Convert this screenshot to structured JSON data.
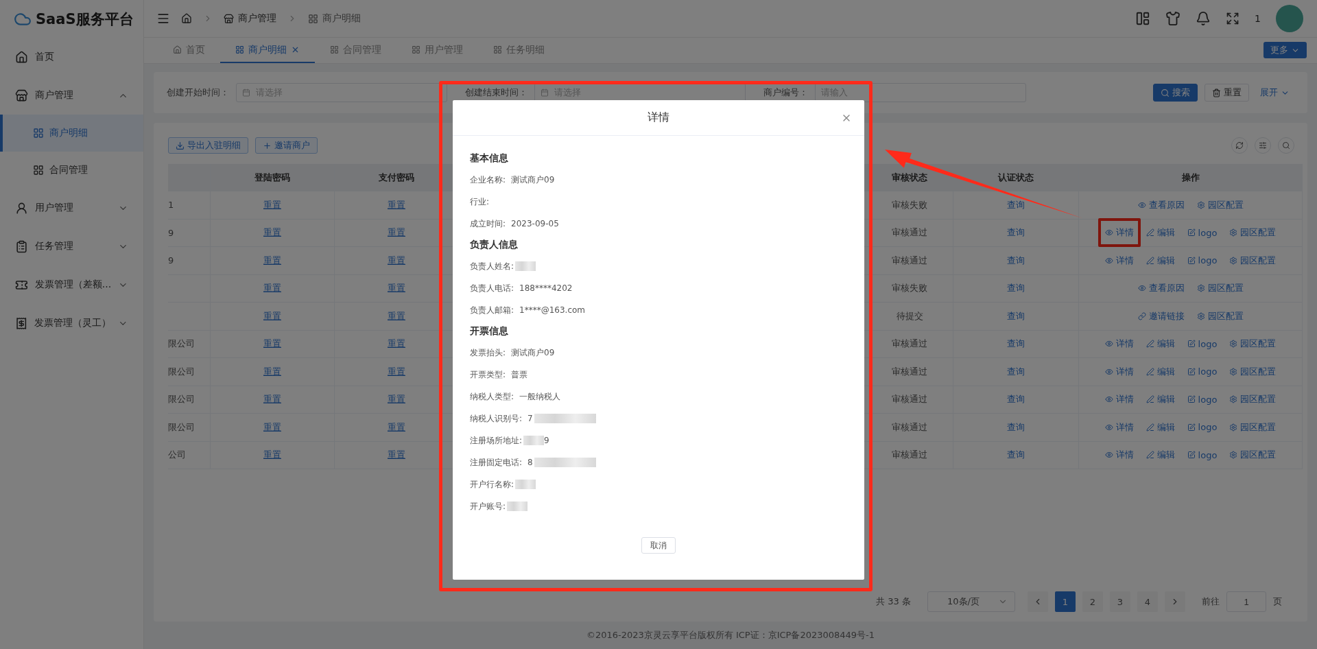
{
  "sidebar": {
    "logo": "SaaS服务平台",
    "items": [
      {
        "kind": "link",
        "label": "首页",
        "selected": false
      },
      {
        "kind": "group",
        "label": "商户管理",
        "expanded": true,
        "children": [
          {
            "label": "商户明细",
            "selected": true
          },
          {
            "label": "合同管理",
            "selected": false
          }
        ]
      },
      {
        "kind": "group",
        "label": "用户管理",
        "expanded": false
      },
      {
        "kind": "group",
        "label": "任务管理",
        "expanded": false
      },
      {
        "kind": "group",
        "label": "发票管理（差额...",
        "expanded": false
      },
      {
        "kind": "group",
        "label": "发票管理（灵工）",
        "expanded": false
      }
    ]
  },
  "header": {
    "breadcrumb": [
      "商户管理",
      "商户明细"
    ],
    "user_count": "1"
  },
  "tabs": [
    {
      "label": "首页",
      "selected": false,
      "closable": false
    },
    {
      "label": "商户明细",
      "selected": true,
      "closable": true
    },
    {
      "label": "合同管理",
      "selected": false,
      "closable": false
    },
    {
      "label": "用户管理",
      "selected": false,
      "closable": false
    },
    {
      "label": "任务明细",
      "selected": false,
      "closable": false
    }
  ],
  "more_button": "更多",
  "filters": [
    {
      "label": "创建开始时间：",
      "placeholder": "请选择",
      "kind": "date"
    },
    {
      "label": "创建结束时间：",
      "placeholder": "请选择",
      "kind": "date"
    },
    {
      "label": "商户编号：",
      "placeholder": "请输入",
      "kind": "text"
    }
  ],
  "filter_buttons": {
    "search": "搜索",
    "reset": "重置",
    "expand": "展开"
  },
  "table": {
    "toolbar_buttons": [
      "导出入驻明细",
      "邀请商户"
    ],
    "columns": [
      "登陆密码",
      "支付密码",
      "审核状态",
      "认证状态",
      "操作"
    ],
    "rows": [
      {
        "column_1": "1",
        "login": "重置",
        "pay": "重置",
        "audit": "审核失败",
        "cert": "查询",
        "actions": [
          {
            "kind": "reason",
            "label": "查看原因",
            "highlighted": false
          },
          {
            "kind": "config",
            "label": "园区配置",
            "highlighted": false
          }
        ]
      },
      {
        "column_1": "9",
        "login": "重置",
        "pay": "重置",
        "audit": "审核通过",
        "cert": "查询",
        "actions": [
          {
            "kind": "detail",
            "label": "详情",
            "highlighted": true
          },
          {
            "kind": "edit",
            "label": "编辑",
            "highlighted": false
          },
          {
            "kind": "logo",
            "label": "logo",
            "highlighted": false
          },
          {
            "kind": "config",
            "label": "园区配置",
            "highlighted": false
          }
        ]
      },
      {
        "column_1": "9",
        "login": "重置",
        "pay": "重置",
        "audit": "审核通过",
        "cert": "查询",
        "actions": [
          {
            "kind": "detail",
            "label": "详情",
            "highlighted": false
          },
          {
            "kind": "edit",
            "label": "编辑",
            "highlighted": false
          },
          {
            "kind": "logo",
            "label": "logo",
            "highlighted": false
          },
          {
            "kind": "config",
            "label": "园区配置",
            "highlighted": false
          }
        ]
      },
      {
        "login": "重置",
        "pay": "重置",
        "audit": "审核失败",
        "cert": "查询",
        "actions": [
          {
            "kind": "reason",
            "label": "查看原因",
            "highlighted": false
          },
          {
            "kind": "config",
            "label": "园区配置",
            "highlighted": false
          }
        ]
      },
      {
        "login": "重置",
        "pay": "重置",
        "audit": "待提交",
        "cert": "查询",
        "actions": [
          {
            "kind": "invite",
            "label": "邀请链接",
            "highlighted": false
          },
          {
            "kind": "config",
            "label": "园区配置",
            "highlighted": false
          }
        ]
      },
      {
        "column_1": "限公司",
        "login": "重置",
        "pay": "重置",
        "audit": "审核通过",
        "cert": "查询",
        "actions": [
          {
            "kind": "detail",
            "label": "详情",
            "highlighted": false
          },
          {
            "kind": "edit",
            "label": "编辑",
            "highlighted": false
          },
          {
            "kind": "logo",
            "label": "logo",
            "highlighted": false
          },
          {
            "kind": "config",
            "label": "园区配置",
            "highlighted": false
          }
        ]
      },
      {
        "column_1": "限公司",
        "login": "重置",
        "pay": "重置",
        "audit": "审核通过",
        "cert": "查询",
        "actions": [
          {
            "kind": "detail",
            "label": "详情",
            "highlighted": false
          },
          {
            "kind": "edit",
            "label": "编辑",
            "highlighted": false
          },
          {
            "kind": "logo",
            "label": "logo",
            "highlighted": false
          },
          {
            "kind": "config",
            "label": "园区配置",
            "highlighted": false
          }
        ]
      },
      {
        "column_1": "限公司",
        "login": "重置",
        "pay": "重置",
        "audit": "审核通过",
        "cert": "查询",
        "actions": [
          {
            "kind": "detail",
            "label": "详情",
            "highlighted": false
          },
          {
            "kind": "edit",
            "label": "编辑",
            "highlighted": false
          },
          {
            "kind": "logo",
            "label": "logo",
            "highlighted": false
          },
          {
            "kind": "config",
            "label": "园区配置",
            "highlighted": false
          }
        ]
      },
      {
        "column_1": "限公司",
        "login": "重置",
        "pay": "重置",
        "audit": "审核通过",
        "cert": "查询",
        "actions": [
          {
            "kind": "detail",
            "label": "详情",
            "highlighted": false
          },
          {
            "kind": "edit",
            "label": "编辑",
            "highlighted": false
          },
          {
            "kind": "logo",
            "label": "logo",
            "highlighted": false
          },
          {
            "kind": "config",
            "label": "园区配置",
            "highlighted": false
          }
        ]
      },
      {
        "column_1": "公司",
        "login": "重置",
        "pay": "重置",
        "audit": "审核通过",
        "cert": "查询",
        "actions": [
          {
            "kind": "detail",
            "label": "详情",
            "highlighted": false
          },
          {
            "kind": "edit",
            "label": "编辑",
            "highlighted": false
          },
          {
            "kind": "logo",
            "label": "logo",
            "highlighted": false
          },
          {
            "kind": "config",
            "label": "园区配置",
            "highlighted": false
          }
        ]
      }
    ]
  },
  "pagination": {
    "total": "共 33 条",
    "page_size": "10条/页",
    "pages": [
      {
        "label": "1",
        "selected": true
      },
      {
        "label": "2",
        "selected": false
      },
      {
        "label": "3",
        "selected": false
      },
      {
        "label": "4",
        "selected": false
      }
    ],
    "goto_label": "前往",
    "goto_value": "1",
    "page_suffix": "页"
  },
  "footer": "©2016-2023京灵云享平台版权所有 ICP证：京ICP备2023008449号-1",
  "modal": {
    "title": "详情",
    "sections": [
      {
        "heading": "基本信息",
        "fields": [
          {
            "label": "企业名称:",
            "value": "测试商户09",
            "redacted": false
          },
          {
            "label": "行业:",
            "redacted": false
          },
          {
            "label": "成立时间:",
            "value": "2023-09-05",
            "redacted": false
          }
        ]
      },
      {
        "heading": "负责人信息",
        "fields": [
          {
            "label": "负责人姓名:",
            "redacted": true
          },
          {
            "label": "负责人电话:",
            "value": "188****4202",
            "redacted": false
          },
          {
            "label": "负责人邮箱:",
            "value": "1****@163.com",
            "redacted": false
          }
        ]
      },
      {
        "heading": "开票信息",
        "fields": [
          {
            "label": "发票抬头:",
            "value": "测试商户09",
            "redacted": false
          },
          {
            "label": "开票类型:",
            "value": "普票",
            "redacted": false
          },
          {
            "label": "纳税人类型:",
            "value": "一般纳税人",
            "redacted": false
          },
          {
            "label": "纳税人识别号:",
            "value": "7",
            "redacted": true
          },
          {
            "label": "注册场所地址:",
            "redacted": true,
            "value_end": "9"
          },
          {
            "label": "注册固定电话:",
            "value": "8",
            "redacted": true
          },
          {
            "label": "开户行名称:",
            "redacted": true
          },
          {
            "label": "开户账号:",
            "redacted": true
          }
        ]
      }
    ],
    "cancel": "取消"
  }
}
